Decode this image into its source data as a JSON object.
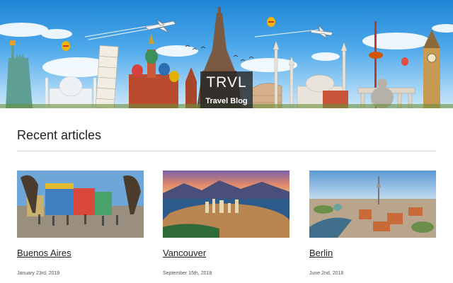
{
  "header": {
    "brand": "TRVL",
    "tagline": "Travel Blog"
  },
  "section": {
    "title": "Recent articles"
  },
  "articles": [
    {
      "title": "Buenos Aires",
      "date": "January 23rd, 2019"
    },
    {
      "title": "Vancouver",
      "date": "September 15th, 2018"
    },
    {
      "title": "Berlin",
      "date": "June 2nd, 2018"
    }
  ],
  "colors": {
    "sky": "#4fa9ea",
    "logo_bg": "#282828",
    "text": "#222222"
  }
}
